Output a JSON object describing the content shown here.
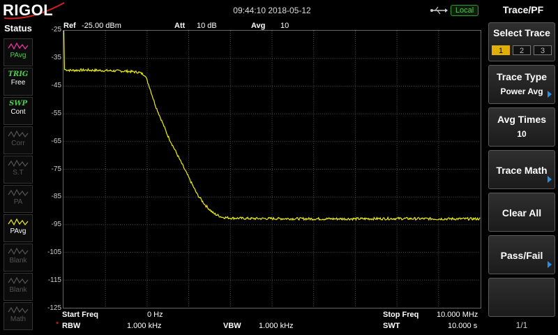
{
  "header": {
    "logo": "RIGOL",
    "datetime": "09:44:10 2018-05-12",
    "local_label": "Local",
    "usb_icon": "usb-icon"
  },
  "top_bar": {
    "ref_label": "Ref",
    "ref_value": "-25.00 dBm",
    "att_label": "Att",
    "att_value": "10 dB",
    "avg_label": "Avg",
    "avg_value": "10"
  },
  "status": {
    "title": "Status",
    "items": [
      {
        "icon": "RMS",
        "text": "PAvg",
        "active": true
      },
      {
        "icon": "TRIG",
        "text": "Free",
        "active": true
      },
      {
        "icon": "SWP",
        "text": "Cont",
        "active": true
      },
      {
        "icon": "corr-icon",
        "text": "Corr",
        "active": false
      },
      {
        "icon": "st-icon",
        "text": "S.T",
        "active": false
      },
      {
        "icon": "pa-icon",
        "text": "PA",
        "active": false
      },
      {
        "icon": "pavg-icon",
        "text": "PAvg",
        "active": true
      },
      {
        "icon": "blank-icon",
        "text": "Blank",
        "active": false
      },
      {
        "icon": "blank-icon",
        "text": "Blank",
        "active": false
      },
      {
        "icon": "math-icon",
        "text": "Math",
        "active": false
      }
    ]
  },
  "menu": {
    "title": "Trace/PF",
    "select_trace": {
      "label": "Select Trace",
      "options": [
        "1",
        "2",
        "3"
      ],
      "selected": "1"
    },
    "trace_type": {
      "label": "Trace Type",
      "value": "Power Avg"
    },
    "avg_times": {
      "label": "Avg Times",
      "value": "10"
    },
    "trace_math": {
      "label": "Trace Math"
    },
    "clear_all": {
      "label": "Clear All"
    },
    "pass_fail": {
      "label": "Pass/Fail"
    },
    "page": "1/1"
  },
  "bottom_bar": {
    "start_label": "Start Freq",
    "start_value": "0 Hz",
    "stop_label": "Stop Freq",
    "stop_value": "10.000 MHz",
    "rbw_label": "RBW",
    "rbw_value": "1.000 kHz",
    "vbw_label": "VBW",
    "vbw_value": "1.000 kHz",
    "swt_label": "SWT",
    "swt_value": "10.000 s"
  },
  "colors": {
    "trace": "#f0f000",
    "accent": "#2e8fe0",
    "active_status": "#4ecb4e",
    "selected_trace": "#e0b000"
  },
  "chart_data": {
    "type": "line",
    "y_ticks": [
      "-25",
      "-35",
      "-45",
      "-55",
      "-65",
      "-75",
      "-85",
      "-95",
      "-105",
      "-115",
      "-125"
    ],
    "ylim": [
      -125,
      -25
    ],
    "xlim_mhz": [
      0,
      10
    ],
    "series": [
      {
        "x_mhz": [
          0,
          0.01,
          0.15,
          0.5,
          1.0,
          1.5,
          1.8,
          1.95,
          2.05,
          2.2,
          2.5,
          2.8,
          3.0,
          3.2,
          3.4,
          3.6,
          3.8,
          4.0,
          4.5,
          5.0,
          6.0,
          7.0,
          8.0,
          9.0,
          10.0
        ],
        "y_dbm": [
          -25,
          -39,
          -39.3,
          -39.2,
          -39.4,
          -39.6,
          -40,
          -41,
          -45,
          -52,
          -63,
          -72,
          -78,
          -84,
          -88,
          -91,
          -92.3,
          -92.6,
          -92.8,
          -92.8,
          -92.9,
          -92.9,
          -92.8,
          -92.9,
          -92.9
        ]
      }
    ]
  }
}
